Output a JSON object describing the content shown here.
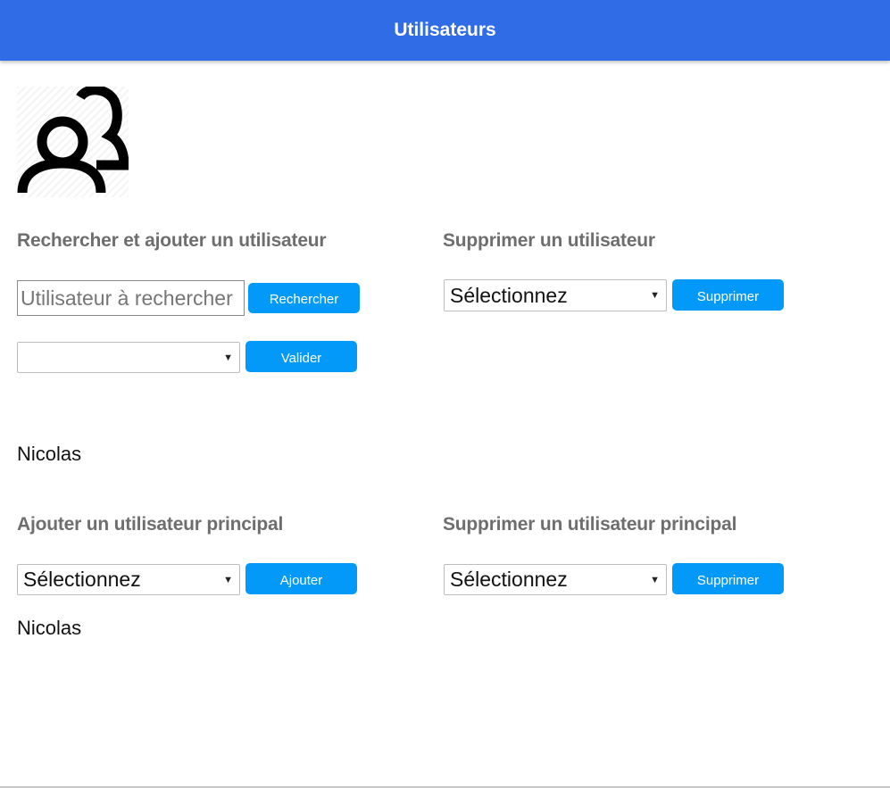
{
  "header": {
    "title": "Utilisateurs"
  },
  "icons": {
    "users": "users-group-icon",
    "dropdown": "chevron-down-icon"
  },
  "colors": {
    "header": "#2f6ce5",
    "button": "#0399f8",
    "section_title": "#6e6e6e"
  },
  "search_add": {
    "title": "Rechercher et ajouter un utilisateur",
    "search_placeholder": "Utilisateur à rechercher",
    "search_button": "Rechercher",
    "select_value": "",
    "validate_button": "Valider"
  },
  "delete_user": {
    "title": "Supprimer un utilisateur",
    "select_value": "Sélectionnez",
    "delete_button": "Supprimer"
  },
  "user_list": {
    "name": "Nicolas"
  },
  "add_principal": {
    "title": "Ajouter un utilisateur principal",
    "select_value": "Sélectionnez",
    "add_button": "Ajouter",
    "principal_name": "Nicolas"
  },
  "delete_principal": {
    "title": "Supprimer un utilisateur principal",
    "select_value": "Sélectionnez",
    "delete_button": "Supprimer"
  }
}
